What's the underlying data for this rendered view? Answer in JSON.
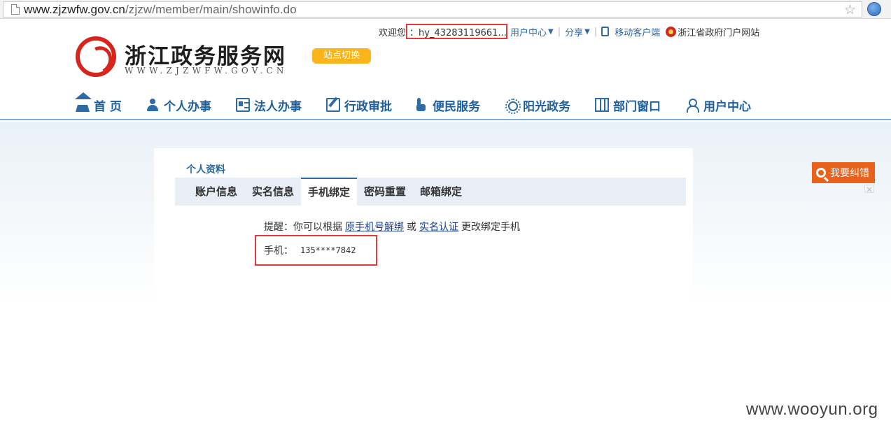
{
  "browser": {
    "url_host": "www.zjzwfw.gov.cn",
    "url_path": "/zjzw/member/main/showinfo.do"
  },
  "toplinks": {
    "welcome": "欢迎您",
    "username": "：hy_43283119661...",
    "user_center": "用户中心",
    "share": "分享",
    "mobile_client": "移动客户端",
    "gov_portal": "浙江省政府门户网站"
  },
  "logo": {
    "name_cn": "浙江政务服务网",
    "name_en": "WWW.ZJZWFW.GOV.CN",
    "site_switch": "站点切换"
  },
  "nav": {
    "items": [
      {
        "label": "首 页",
        "icon": "home-icon"
      },
      {
        "label": "个人办事",
        "icon": "person-icon"
      },
      {
        "label": "法人办事",
        "icon": "id-card-icon"
      },
      {
        "label": "行政审批",
        "icon": "edit-icon"
      },
      {
        "label": "便民服务",
        "icon": "hand-icon"
      },
      {
        "label": "阳光政务",
        "icon": "sun-icon"
      },
      {
        "label": "部门窗口",
        "icon": "building-icon"
      },
      {
        "label": "用户中心",
        "icon": "user-icon"
      }
    ]
  },
  "panel": {
    "title": "个人资料",
    "tabs": [
      "账户信息",
      "实名信息",
      "手机绑定",
      "密码重置",
      "邮箱绑定"
    ],
    "active_tab": "手机绑定"
  },
  "binding": {
    "hint_prefix": "提醒：你可以根据",
    "link_unbind": "原手机号解绑",
    "or": "或",
    "link_realname": "实名认证",
    "hint_suffix": "更改绑定手机",
    "phone_label": "手机：",
    "phone_value": "135****7842"
  },
  "feedback": {
    "label": "我要纠错",
    "close": "×"
  },
  "watermark": "www.wooyun.org",
  "colors": {
    "accent": "#2d6aa6",
    "highlight_box": "#e03c3c",
    "site_switch": "#f8b41a",
    "feedback": "#e8621c"
  }
}
